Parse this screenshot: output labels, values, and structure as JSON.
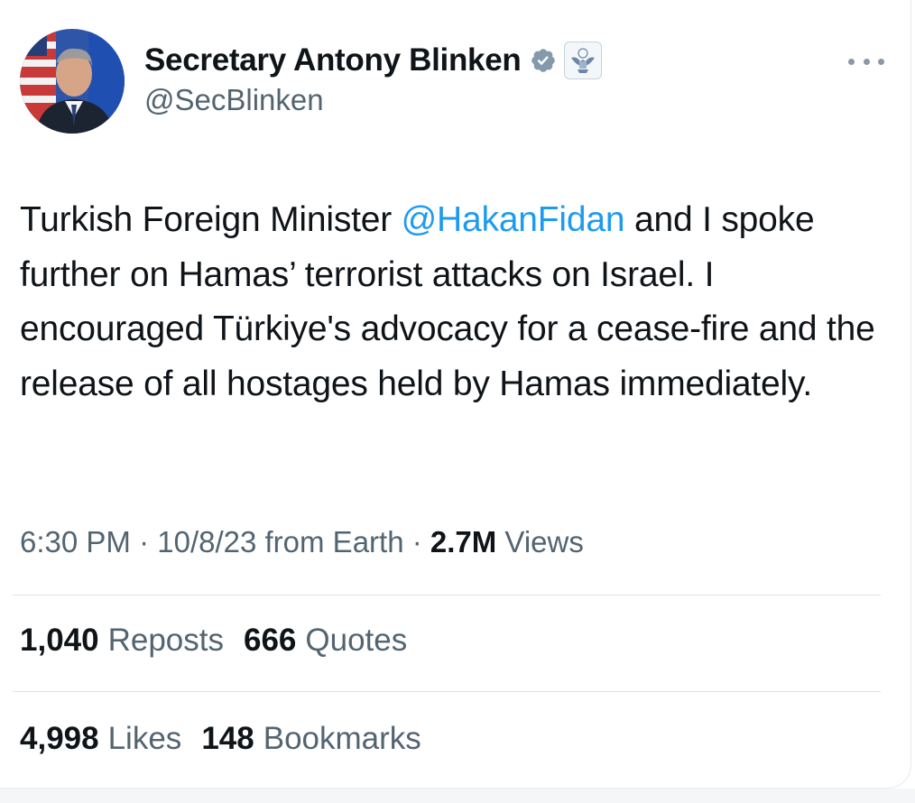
{
  "author": {
    "display_name": "Secretary Antony Blinken",
    "handle": "@SecBlinken",
    "avatar_icon": "profile-photo",
    "verified_icon": "gray-verified-badge-icon",
    "affiliation_icon": "state-department-seal-icon"
  },
  "tweet": {
    "text_before": "Turkish Foreign Minister ",
    "mention": "@HakanFidan",
    "text_after": " and I spoke further on Hamas’ terrorist attacks on Israel. I encouraged Türkiye's advocacy for a cease-fire and the release of all hostages held by Hamas immediately."
  },
  "meta": {
    "time": "6:30 PM",
    "sep1": " · ",
    "date": "10/8/23",
    "source": " from Earth",
    "sep2": " · ",
    "views_count": "2.7M",
    "views_label": " Views"
  },
  "stats": {
    "reposts_count": "1,040",
    "reposts_label": "Reposts",
    "quotes_count": "666",
    "quotes_label": "Quotes",
    "likes_count": "4,998",
    "likes_label": "Likes",
    "bookmarks_count": "148",
    "bookmarks_label": "Bookmarks"
  },
  "colors": {
    "mention": "#1d9bf0",
    "secondary_text": "#536471",
    "primary_text": "#0f1419",
    "verified_badge": "#829aab"
  }
}
